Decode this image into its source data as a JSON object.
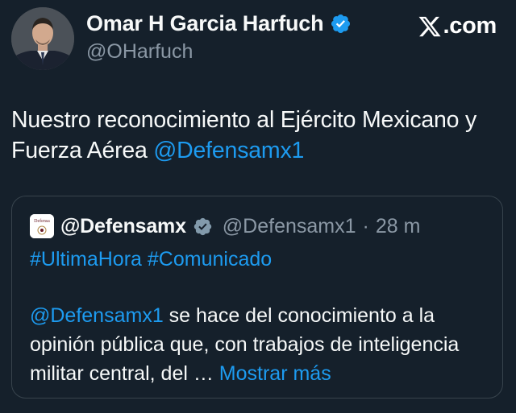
{
  "author": {
    "display_name": "Omar H Garcia Harfuch",
    "handle": "@OHarfuch",
    "verified": true
  },
  "brand": {
    "logo_icon": "x-logo-icon",
    "text": ".com"
  },
  "tweet": {
    "text_before": "Nuestro reconocimiento al Ejército Mexicano y Fuerza Aérea ",
    "mention": "@Defensamx1"
  },
  "quoted": {
    "avatar_label": "Defensa",
    "display_name": "@Defensamx",
    "verified": true,
    "verified_color": "gray",
    "handle": "@Defensamx1",
    "separator": "·",
    "time": "28 m",
    "hashtag_1": "#UltimaHora",
    "hashtag_2": "#Comunicado",
    "body_mention": "@Defensamx1",
    "body_text": "  se hace del conocimiento a la opinión pública que, con trabajos de inteligencia militar central, del … ",
    "show_more": "Mostrar más"
  },
  "colors": {
    "background": "#15202b",
    "text": "#f7f9f9",
    "secondary_text": "#8b98a5",
    "accent": "#1d9bf0",
    "border": "#38444d"
  }
}
